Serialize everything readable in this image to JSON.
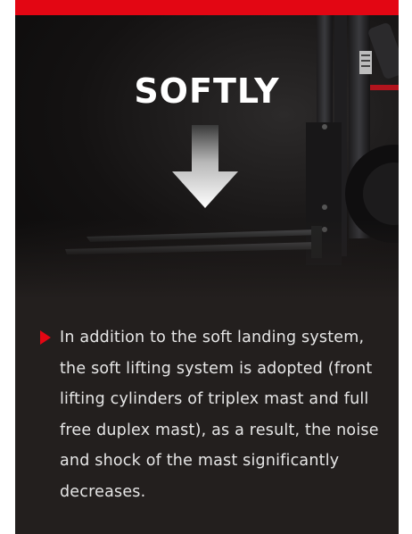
{
  "panel": {
    "title": "SOFTLY",
    "description": "In addition to the soft landing system, the soft lifting system is adopted (front lifting cylinders of triplex mast and full free duplex mast), as a result, the noise and shock of the mast significantly decreases."
  },
  "icons": {
    "arrow": "down-arrow-icon",
    "bullet": "triangle-bullet-icon"
  },
  "colors": {
    "accent": "#e30613",
    "background": "#231f1e",
    "text": "#e6e6e6",
    "title": "#ffffff"
  }
}
